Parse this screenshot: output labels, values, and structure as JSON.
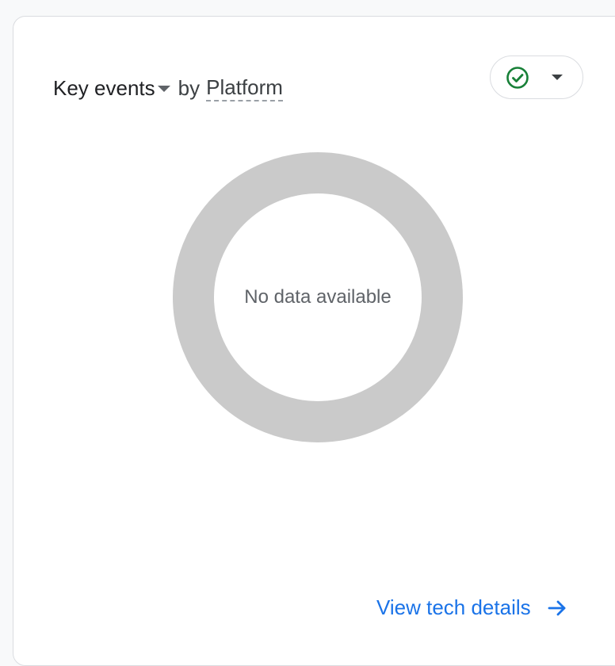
{
  "card": {
    "metric_label": "Key events",
    "by_label": "by",
    "dimension_label": "Platform",
    "status_chip": {
      "icon": "check-circle-icon",
      "icon_color": "#188038"
    }
  },
  "chart": {
    "empty_message": "No data available",
    "ring_color": "#cacaca"
  },
  "footer": {
    "link_label": "View tech details",
    "link_color": "#1a73e8",
    "icon": "arrow-right-icon"
  }
}
